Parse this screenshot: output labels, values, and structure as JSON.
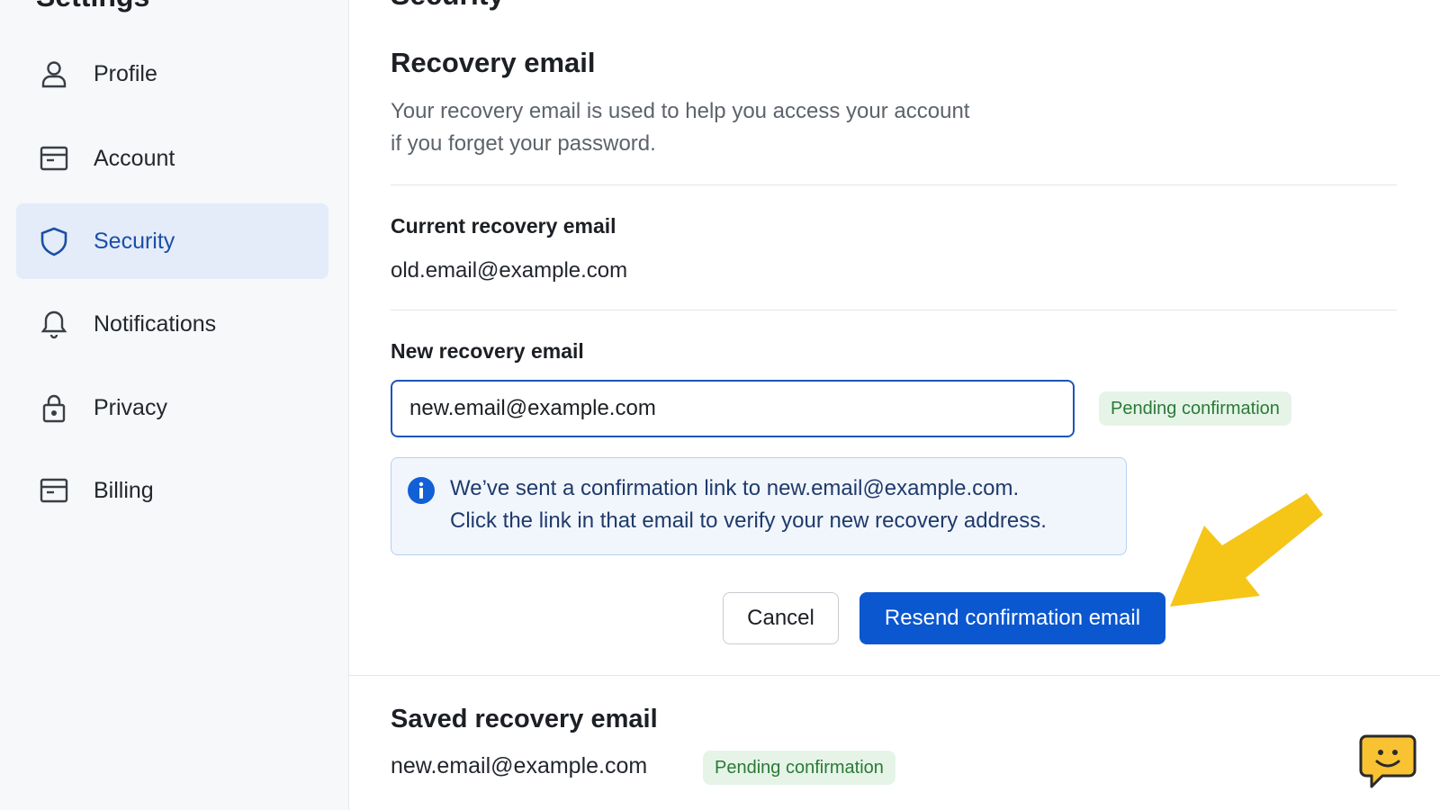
{
  "sidebar": {
    "title": "Settings",
    "items": [
      {
        "label": "Profile",
        "icon": "user-icon"
      },
      {
        "label": "Account",
        "icon": "card-icon"
      },
      {
        "label": "Security",
        "icon": "shield-icon",
        "active": true
      },
      {
        "label": "Notifications",
        "icon": "bell-icon"
      },
      {
        "label": "Privacy",
        "icon": "lock-icon"
      },
      {
        "label": "Billing",
        "icon": "card-icon"
      }
    ]
  },
  "main": {
    "title": "Security",
    "recovery": {
      "heading": "Recovery email",
      "description_line1": "Your recovery email is used to help you access your account",
      "description_line2": "if you forget your password.",
      "current_label": "Current recovery email",
      "current_value": "old.email@example.com",
      "new_label": "New recovery email",
      "new_value": "new.email@example.com",
      "status_badge": "Pending confirmation",
      "info_line1": "We’ve sent a confirmation link to new.email@example.com.",
      "info_line2": "Click the link in that email to verify your new recovery address.",
      "cancel_label": "Cancel",
      "resend_label": "Resend confirmation email"
    },
    "saved": {
      "heading": "Saved recovery email",
      "value": "new.email@example.com",
      "status_badge": "Pending confirmation"
    }
  },
  "colors": {
    "accent": "#0b57cf",
    "active_nav_bg": "#e3ecf8",
    "badge_bg": "#e6f4e8",
    "badge_text": "#2a7a36",
    "arrow": "#f5c518",
    "chat_bubble": "#f8c232"
  }
}
